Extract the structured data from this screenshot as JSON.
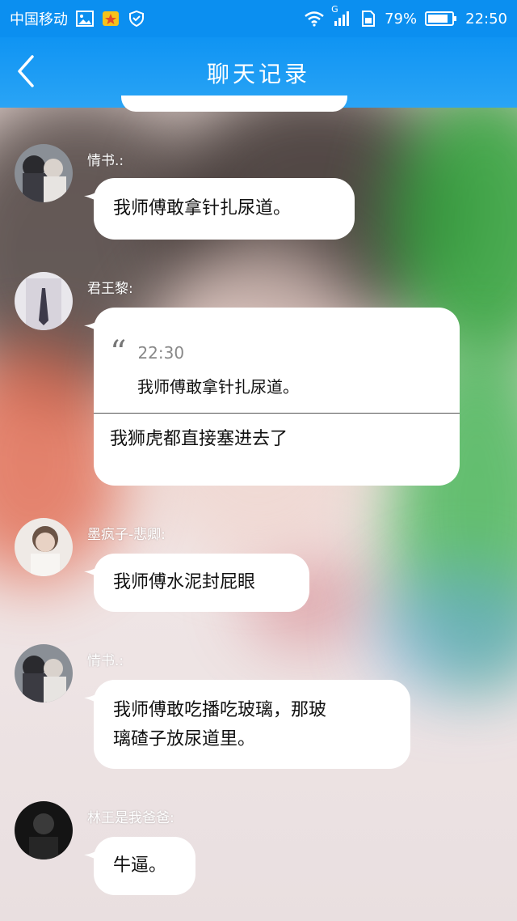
{
  "status_bar": {
    "carrier": "中国移动",
    "signal_type": "G",
    "battery": "79%",
    "time": "22:50"
  },
  "header": {
    "title": "聊天记录",
    "back_icon": "chevron-left-icon"
  },
  "colors": {
    "accent": "#0b8ff0",
    "bubble": "#ffffff"
  },
  "messages": [
    {
      "sender": "情书.:",
      "text": "我师傅敢拿针扎尿道。"
    },
    {
      "sender": "君王黎:",
      "quote_time": "22:30",
      "quote_text": "我师傅敢拿针扎尿道。",
      "text": "我狮虎都直接塞进去了"
    },
    {
      "sender": "墨疯子-悲卿:",
      "text": "我师傅水泥封屁眼"
    },
    {
      "sender": "情书.:",
      "text_line1": "我师傅敢吃播吃玻璃，那玻",
      "text_line2": "璃碴子放尿道里。"
    },
    {
      "sender": "林王是我爸爸:",
      "text": "牛逼。"
    }
  ]
}
